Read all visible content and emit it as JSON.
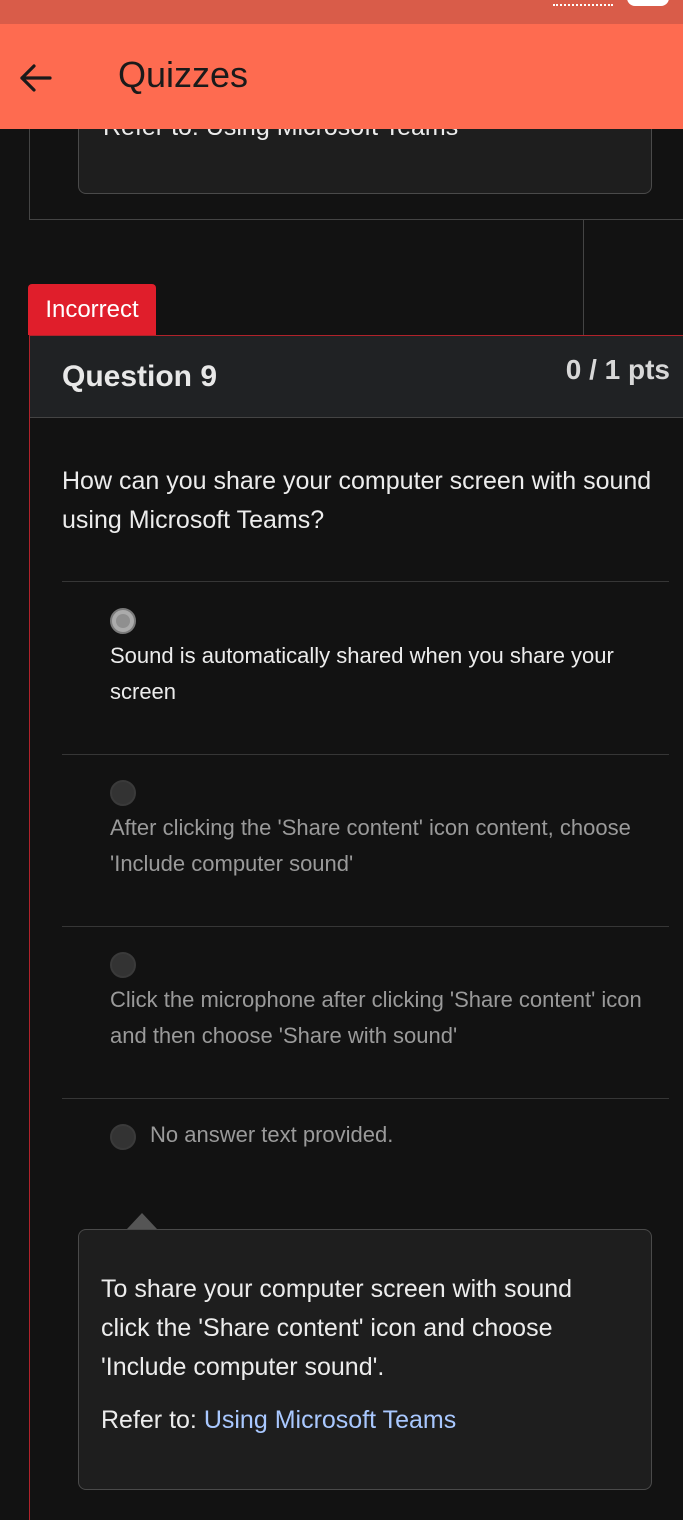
{
  "app_bar": {
    "title": "Quizzes"
  },
  "previous_question": {
    "refer_label": "Refer to:",
    "refer_link": "Using Microsoft Teams"
  },
  "question": {
    "status_badge": "Incorrect",
    "title": "Question 9",
    "points": "0 / 1 pts",
    "text": "How can you share your computer screen with sound using Microsoft Teams?",
    "options": [
      {
        "label": "Sound is automatically shared when you share your screen",
        "selected": true
      },
      {
        "label": "After clicking the 'Share content' icon content, choose 'Include computer sound'",
        "selected": false
      },
      {
        "label": "Click the microphone after clicking 'Share content' icon and then choose 'Share with sound'",
        "selected": false
      },
      {
        "label": "No answer text provided.",
        "selected": false
      }
    ]
  },
  "feedback": {
    "text": "To share your computer screen with sound click the 'Share content' icon and choose 'Include computer sound'.",
    "refer_label": "Refer to:",
    "refer_link": "Using Microsoft Teams"
  },
  "colors": {
    "app_bar": "#fe6b50",
    "incorrect_badge": "#e01e2b",
    "link": "#a9c8ff",
    "background": "#121212"
  },
  "icons": {
    "back": "arrow-left-icon"
  }
}
